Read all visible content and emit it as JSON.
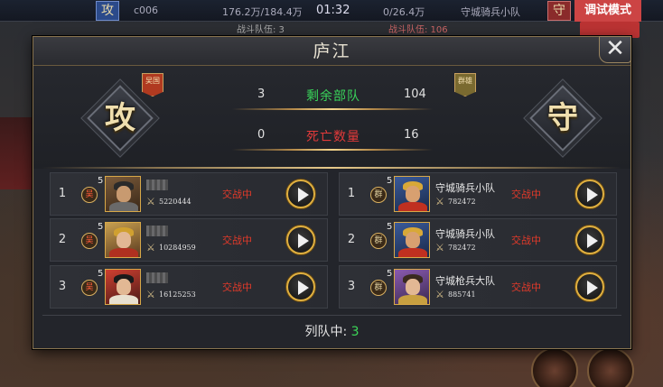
{
  "topbar": {
    "attack_badge": "攻",
    "left_code": "c006",
    "left_troops": "176.2万/184.4万",
    "timer": "01:32",
    "right_troops": "0/26.4万",
    "right_unit": "守城骑兵小队",
    "defense_badge": "守",
    "debug_mode": "调试模式",
    "left_sub": "战斗队伍: 3",
    "right_sub": "战斗队伍: 106"
  },
  "modal": {
    "title": "庐江",
    "close_label": "✕"
  },
  "summary": {
    "attacker_label": "攻",
    "defender_label": "守",
    "attacker_faction": "吴国",
    "defender_faction": "群雄",
    "remaining_label": "剩余部队",
    "attacker_remaining": "3",
    "defender_remaining": "104",
    "deaths_label": "死亡数量",
    "attacker_deaths": "0",
    "defender_deaths": "16"
  },
  "attackers": [
    {
      "index": "1",
      "faction": "吴",
      "level": "5",
      "name": "",
      "power": "5220444",
      "status": "交战中"
    },
    {
      "index": "2",
      "faction": "吴",
      "level": "5",
      "name": "",
      "power": "10284959",
      "status": "交战中"
    },
    {
      "index": "3",
      "faction": "吴",
      "level": "5",
      "name": "",
      "power": "16125253",
      "status": "交战中"
    }
  ],
  "defenders": [
    {
      "index": "1",
      "faction": "群",
      "level": "5",
      "name": "守城骑兵小队",
      "power": "782472",
      "status": "交战中"
    },
    {
      "index": "2",
      "faction": "群",
      "level": "5",
      "name": "守城骑兵小队",
      "power": "782472",
      "status": "交战中"
    },
    {
      "index": "3",
      "faction": "群",
      "level": "5",
      "name": "守城枪兵大队",
      "power": "885741",
      "status": "交战中"
    }
  ],
  "footer": {
    "label": "列队中:",
    "value": "3"
  },
  "colors": {
    "remaining": "#39d45a",
    "deaths": "#e33a3a",
    "status": "#e23a2a",
    "queue": "#3cd858",
    "gold_border": "#d8a848"
  }
}
